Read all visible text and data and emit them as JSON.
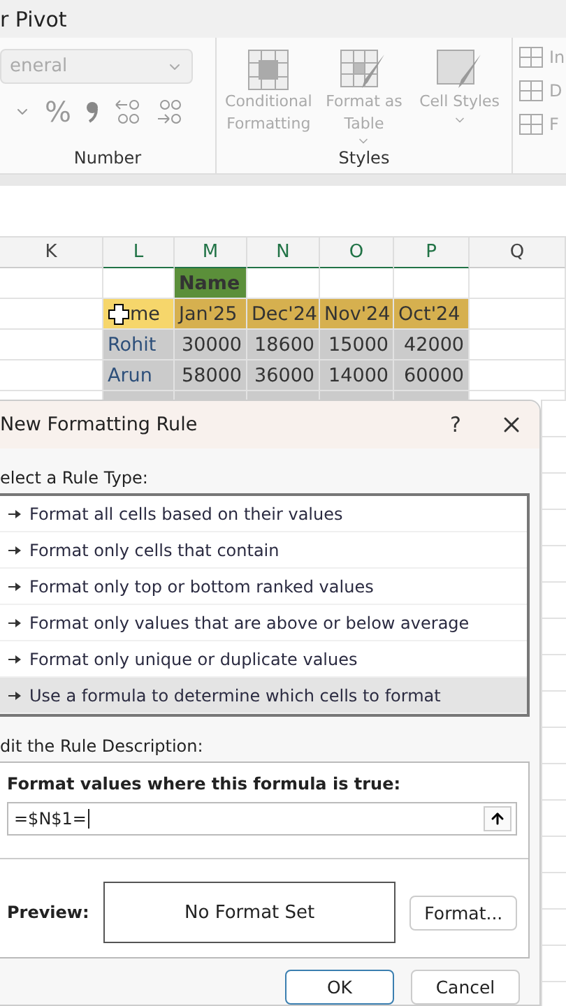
{
  "ribbon": {
    "tab_label": "r Pivot",
    "number_group": {
      "format_value": "eneral",
      "percent": "%",
      "label": "Number"
    },
    "styles_group": {
      "items": [
        {
          "label": "Conditional Formatting",
          "dropdown": false
        },
        {
          "label": "Format as Table",
          "dropdown": true
        },
        {
          "label": "Cell Styles",
          "dropdown": true
        }
      ],
      "label": "Styles"
    },
    "cells_group": {
      "items": [
        "In",
        "D",
        "F"
      ]
    }
  },
  "sheet": {
    "columns": [
      "K",
      "L",
      "M",
      "N",
      "O",
      "P",
      "Q"
    ],
    "rows": [
      {
        "kind": "title",
        "cells": [
          "",
          "",
          "Name",
          "",
          "",
          "",
          ""
        ]
      },
      {
        "kind": "header",
        "cells": [
          "",
          "me",
          "Jan'25",
          "Dec'24",
          "Nov'24",
          "Oct'24",
          ""
        ]
      },
      {
        "kind": "data",
        "cells": [
          "",
          "Rohit",
          "30000",
          "18600",
          "15000",
          "42000",
          ""
        ]
      },
      {
        "kind": "data",
        "cells": [
          "",
          "Arun",
          "58000",
          "36000",
          "14000",
          "60000",
          ""
        ]
      }
    ]
  },
  "dialog": {
    "title": "New Formatting Rule",
    "help": "?",
    "rule_type_label": "elect a Rule Type:",
    "rule_types": [
      {
        "label": "Format all cells based on their values",
        "selected": false
      },
      {
        "label": "Format only cells that contain",
        "selected": false
      },
      {
        "label": "Format only top or bottom ranked values",
        "selected": false
      },
      {
        "label": "Format only values that are above or below average",
        "selected": false
      },
      {
        "label": "Format only unique or duplicate values",
        "selected": false
      },
      {
        "label": "Use a formula to determine which cells to format",
        "selected": true
      }
    ],
    "description_label": "dit the Rule Description:",
    "formula_label": "Format values where this formula is true:",
    "formula_value": "=$N$1=",
    "preview_label": "Preview:",
    "preview_text": "No Format Set",
    "format_button": "Format...",
    "buttons": [
      {
        "label": "OK",
        "default": true
      },
      {
        "label": "Cancel",
        "default": false
      }
    ]
  }
}
